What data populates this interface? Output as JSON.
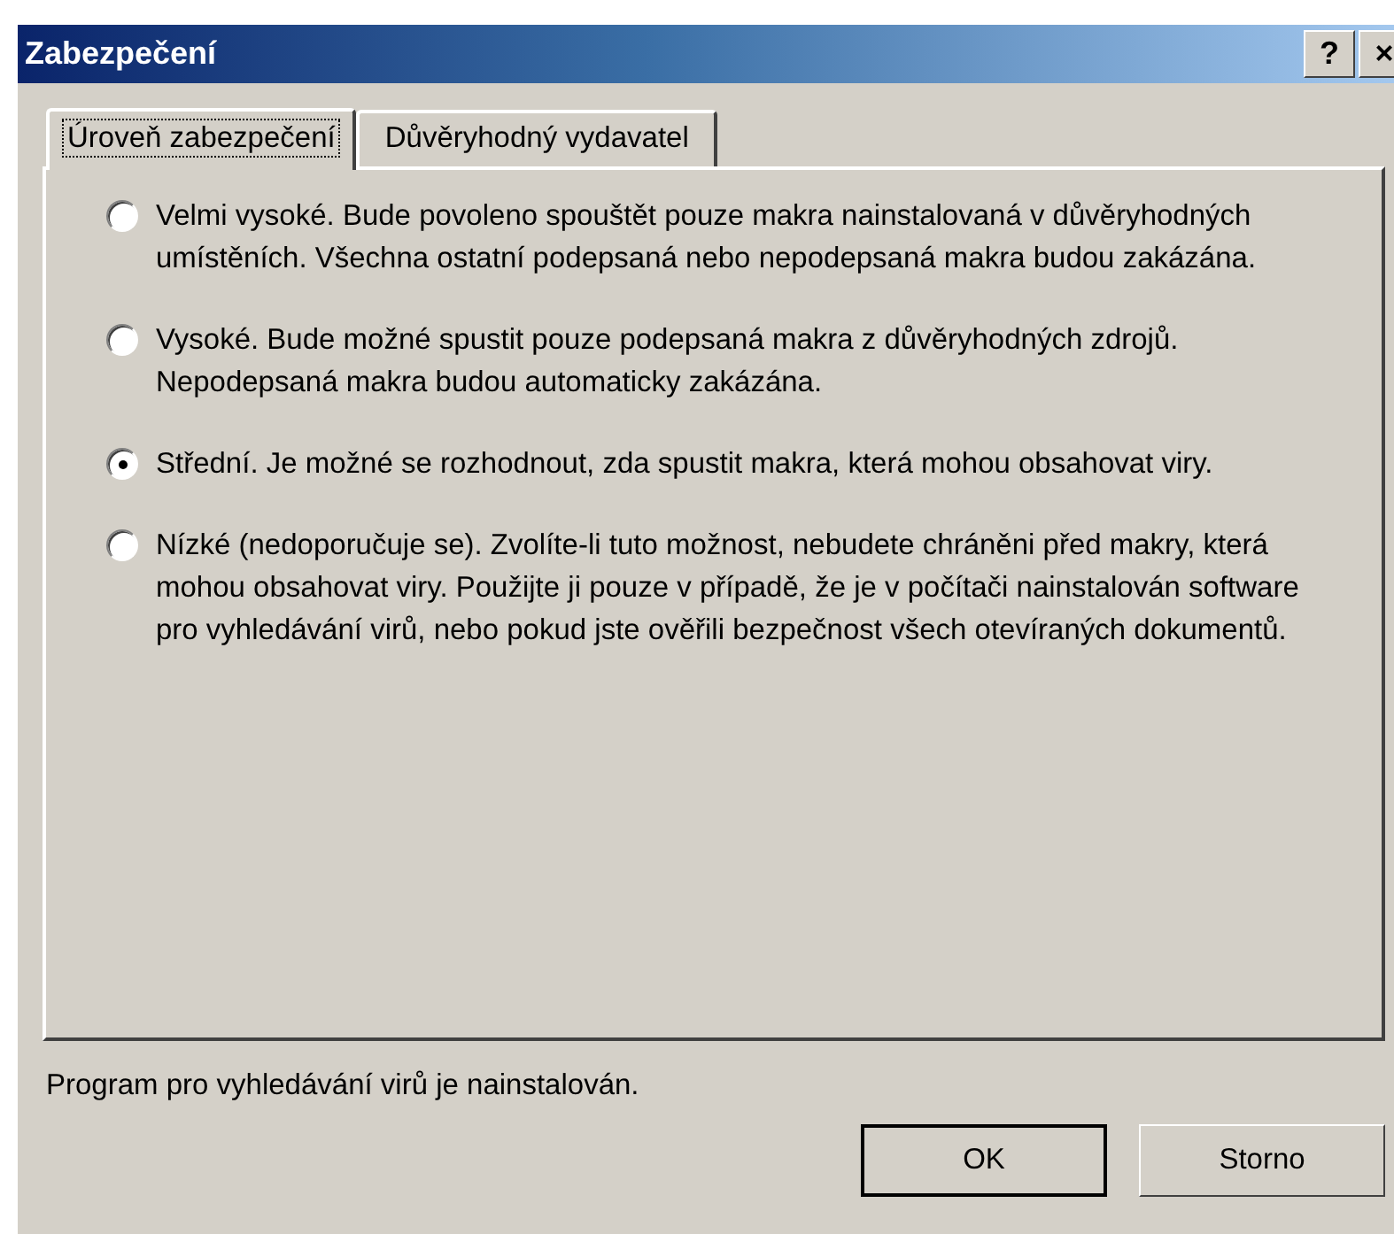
{
  "window": {
    "title": "Zabezpečení",
    "title_buttons": [
      "?",
      "×"
    ]
  },
  "tabs": [
    {
      "label": "Úroveň zabezpečení",
      "selected": true
    },
    {
      "label": "Důvěryhodný vydavatel",
      "selected": false
    }
  ],
  "options": [
    {
      "label": "Velmi vysoké. Bude povoleno spouštět pouze makra nainstalovaná v důvěryhodných umístěních. Všechna ostatní podepsaná nebo nepodepsaná makra budou zakázána.",
      "selected": false
    },
    {
      "label": "Vysoké. Bude možné spustit pouze podepsaná makra z důvěryhodných zdrojů. Nepodepsaná makra budou automaticky zakázána.",
      "selected": false
    },
    {
      "label": "Střední. Je možné se rozhodnout, zda spustit makra, která mohou obsahovat viry.",
      "selected": true
    },
    {
      "label": "Nízké (nedoporučuje se). Zvolíte-li tuto možnost, nebudete chráněni před makry, která mohou obsahovat viry. Použijte ji pouze v případě, že je v počítači nainstalován software pro vyhledávání virů, nebo pokud jste ověřili bezpečnost všech otevíraných dokumentů.",
      "selected": false
    }
  ],
  "status": "Program pro vyhledávání virů je nainstalován.",
  "buttons": [
    "OK",
    "Storno"
  ]
}
